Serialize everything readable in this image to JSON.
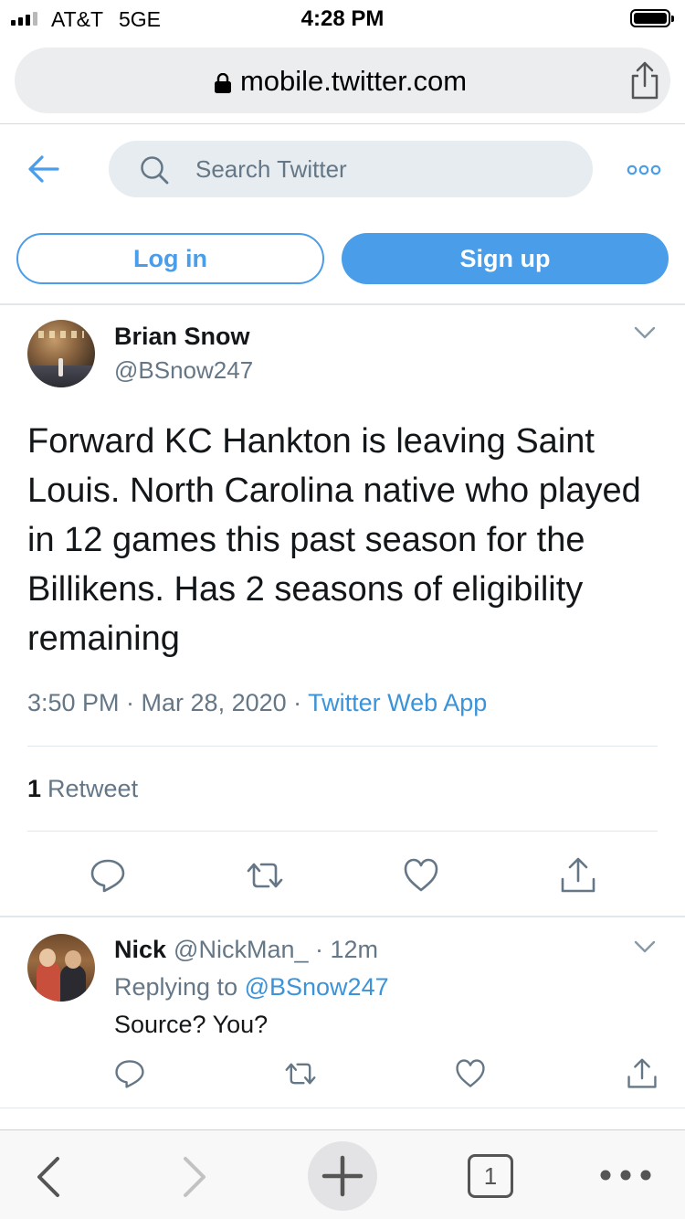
{
  "status_bar": {
    "carrier": "AT&T",
    "network": "5GE",
    "time": "4:28 PM"
  },
  "browser": {
    "url": "mobile.twitter.com",
    "open_tabs": "1"
  },
  "header": {
    "search_placeholder": "Search Twitter",
    "login_label": "Log in",
    "signup_label": "Sign up"
  },
  "tweet": {
    "author_name": "Brian Snow",
    "author_handle": "@BSnow247",
    "text": "Forward KC Hankton is leaving Saint Louis. North Carolina native who played in 12 games this past season for the Billikens. Has 2 seasons of eligibility remaining",
    "time": "3:50 PM · Mar 28, 2020 · ",
    "source": "Twitter Web App",
    "retweet_count": "1",
    "retweet_label": "Retweet"
  },
  "reply": {
    "author_name": "Nick",
    "author_handle": "@NickMan_ · 12m",
    "replying_prefix": "Replying to ",
    "replying_to": "@BSnow247",
    "text": "Source? You?"
  },
  "colors": {
    "twitter_blue": "#4a9de8",
    "link_blue": "#3b94d9",
    "secondary_text": "#657786",
    "icon_gray": "#657786"
  },
  "icons": {
    "back": "arrow-left-icon",
    "search": "search-icon",
    "more": "more-icon",
    "reply": "reply-icon",
    "retweet": "retweet-icon",
    "like": "heart-icon",
    "share": "share-icon"
  }
}
